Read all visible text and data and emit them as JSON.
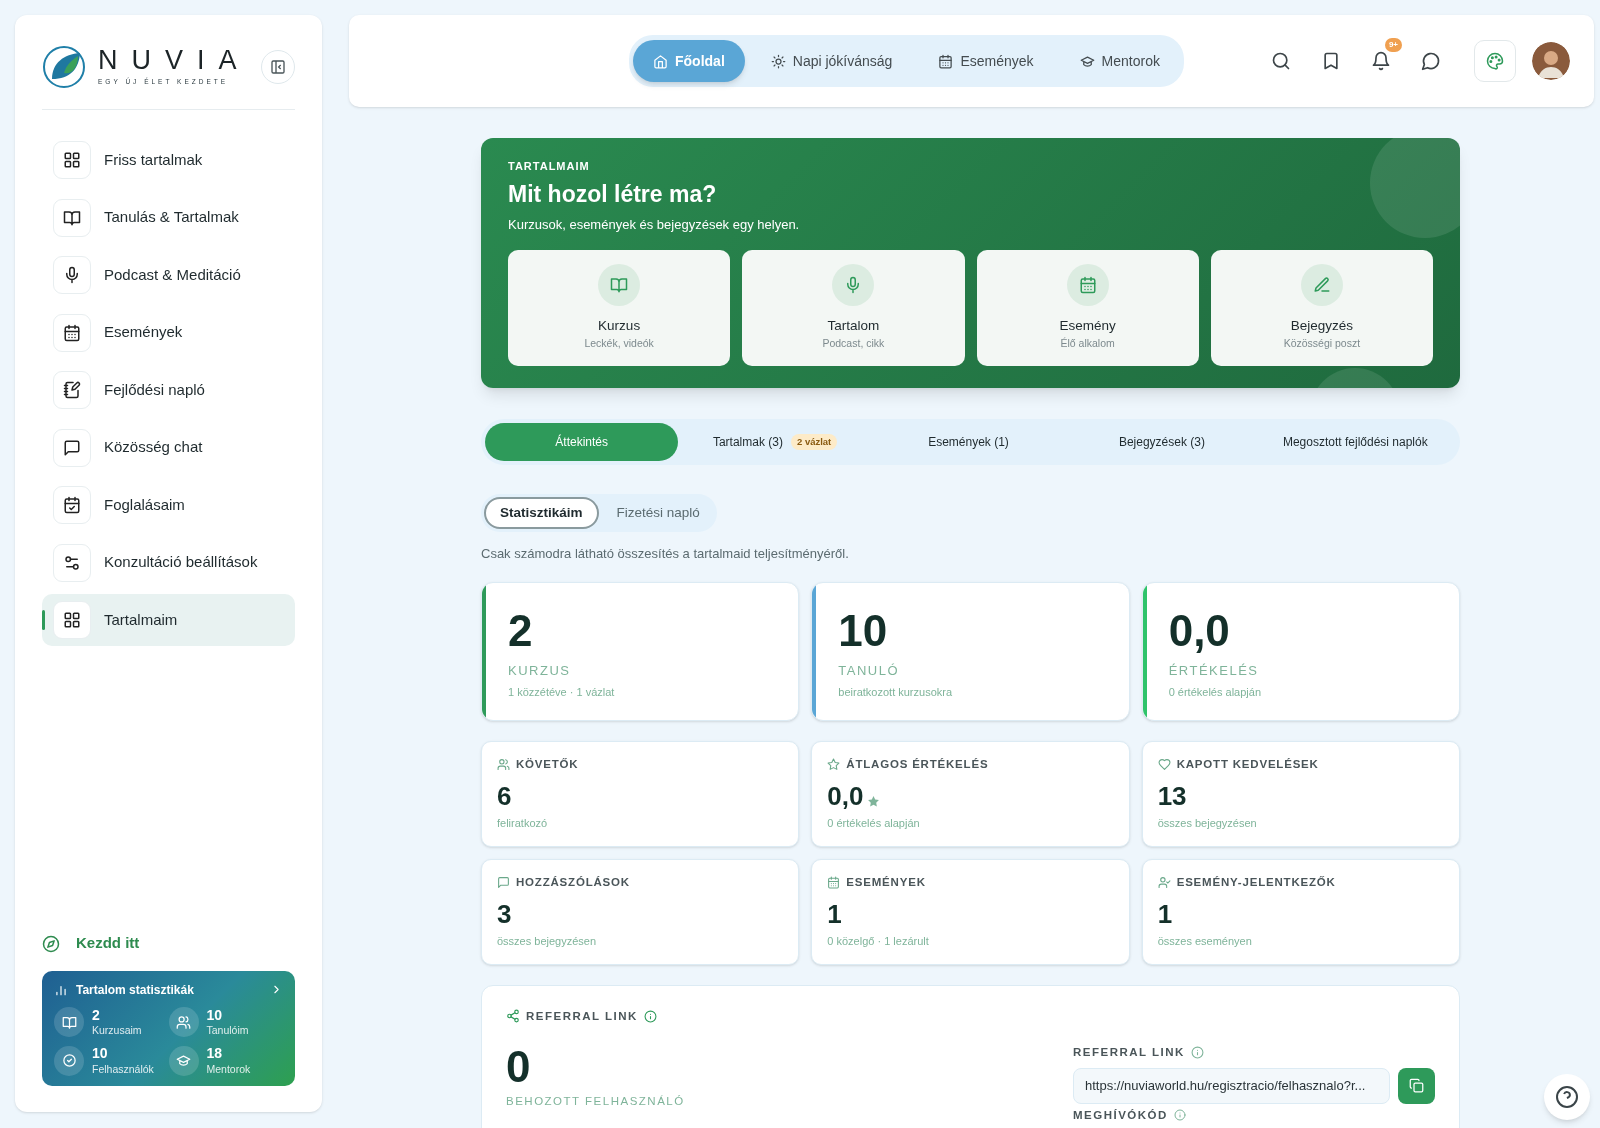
{
  "sidebar": {
    "logo": {
      "name": "NUVIA",
      "tagline": "EGY ÚJ ÉLET KEZDETE"
    },
    "items": [
      {
        "label": "Friss tartalmak",
        "kind": "grid",
        "selected": false
      },
      {
        "label": "Tanulás & Tartalmak",
        "kind": "book",
        "selected": false
      },
      {
        "label": "Podcast & Meditáció",
        "kind": "mic",
        "selected": false
      },
      {
        "label": "Események",
        "kind": "calendar",
        "selected": false
      },
      {
        "label": "Fejlődési napló",
        "kind": "notebook",
        "selected": false
      },
      {
        "label": "Közösség chat",
        "kind": "chat",
        "selected": false
      },
      {
        "label": "Foglalásaim",
        "kind": "calcheck",
        "selected": false
      },
      {
        "label": "Konzultáció beállítások",
        "kind": "sliders",
        "selected": false
      },
      {
        "label": "Tartalmaim",
        "kind": "grid",
        "selected": true
      }
    ],
    "start": {
      "label": "Kezdd itt"
    },
    "stats_card": {
      "title": "Tartalom statisztikák",
      "items": [
        {
          "value": "2",
          "label": "Kurzusaim",
          "kind": "book"
        },
        {
          "value": "10",
          "label": "Tanulóim",
          "kind": "users"
        },
        {
          "value": "10",
          "label": "Felhasználók",
          "kind": "badge"
        },
        {
          "value": "18",
          "label": "Mentorok",
          "kind": "cap"
        }
      ]
    }
  },
  "topbar": {
    "nav": [
      {
        "label": "Főoldal",
        "kind": "home",
        "selected": true
      },
      {
        "label": "Napi jókívánság",
        "kind": "sun",
        "selected": false
      },
      {
        "label": "Események",
        "kind": "calendar",
        "selected": false
      },
      {
        "label": "Mentorok",
        "kind": "cap",
        "selected": false
      }
    ],
    "notification_badge": "9+"
  },
  "hero": {
    "eyebrow": "TARTALMAIM",
    "title": "Mit hozol létre ma?",
    "subtitle": "Kurzusok, események és bejegyzések egy helyen.",
    "actions": [
      {
        "title": "Kurzus",
        "subtitle": "Leckék, videók",
        "kind": "book"
      },
      {
        "title": "Tartalom",
        "subtitle": "Podcast, cikk",
        "kind": "mic"
      },
      {
        "title": "Esemény",
        "subtitle": "Élő alkalom",
        "kind": "calendar"
      },
      {
        "title": "Bejegyzés",
        "subtitle": "Közösségi poszt",
        "kind": "pen"
      }
    ]
  },
  "tabs": [
    {
      "label": "Áttekintés",
      "selected": true
    },
    {
      "label": "Tartalmak (3)",
      "badge": "2 vázlat",
      "selected": false
    },
    {
      "label": "Események (1)",
      "selected": false
    },
    {
      "label": "Bejegyzések (3)",
      "selected": false
    },
    {
      "label": "Megosztott fejlődési naplók",
      "selected": false
    }
  ],
  "subtabs": [
    {
      "label": "Statisztikáim",
      "selected": true
    },
    {
      "label": "Fizetési napló",
      "selected": false
    }
  ],
  "description": "Csak számodra látható összesítés a tartalmaid teljesítményéről.",
  "highlight_cards": [
    {
      "value": "2",
      "label": "KURZUS",
      "note": "1 közzétéve · 1 vázlat",
      "color": "#2e9a5a"
    },
    {
      "value": "10",
      "label": "TANULÓ",
      "note": "beiratkozott kurzusokra",
      "color": "#5aa6d6"
    },
    {
      "value": "0,0",
      "label": "ÉRTÉKELÉS",
      "note": "0 értékelés alapján",
      "color": "#2fc36a"
    }
  ],
  "stat_cards": [
    {
      "label": "KÖVETŐK",
      "value": "6",
      "note": "feliratkozó",
      "kind": "users",
      "value_star": false
    },
    {
      "label": "ÁTLAGOS ÉRTÉKELÉS",
      "value": "0,0",
      "note": "0 értékelés alapján",
      "kind": "star",
      "value_star": true
    },
    {
      "label": "KAPOTT KEDVELÉSEK",
      "value": "13",
      "note": "összes bejegyzésen",
      "kind": "heart",
      "value_star": false
    },
    {
      "label": "HOZZÁSZÓLÁSOK",
      "value": "3",
      "note": "összes bejegyzésen",
      "kind": "chat",
      "value_star": false
    },
    {
      "label": "ESEMÉNYEK",
      "value": "1",
      "note": "0 közelgő · 1 lezárult",
      "kind": "calendar",
      "value_star": false
    },
    {
      "label": "ESEMÉNY-JELENTKEZŐK",
      "value": "1",
      "note": "összes eseményen",
      "kind": "usercheck",
      "value_star": false
    }
  ],
  "referral": {
    "title": "REFERRAL LINK",
    "count": "0",
    "count_label": "BEHOZOTT FELHASZNÁLÓ",
    "link_label": "REFERRAL LINK",
    "link_value": "https://nuviaworld.hu/regisztracio/felhasznalo?r...",
    "code_label": "MEGHÍVÓKÓD"
  }
}
